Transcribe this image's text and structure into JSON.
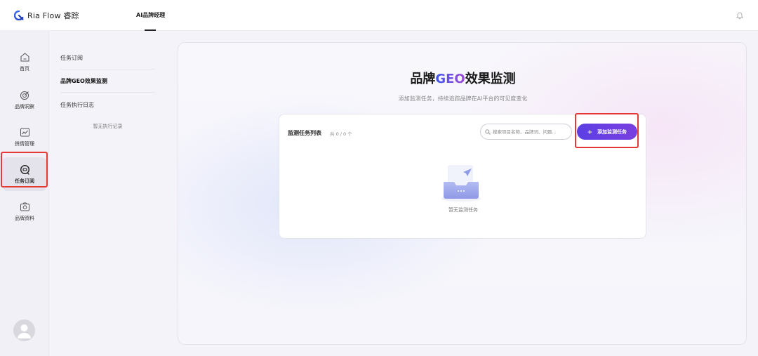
{
  "app": {
    "brand": "Ria Flow 睿踪"
  },
  "header": {
    "nav_item": "AI品牌经理"
  },
  "rail": {
    "items": [
      {
        "label": "首页"
      },
      {
        "label": "品牌洞察"
      },
      {
        "label": "舆情管理"
      },
      {
        "label": "任务订阅"
      },
      {
        "label": "品牌资料"
      }
    ]
  },
  "submenu": {
    "items": [
      {
        "label": "任务订阅"
      },
      {
        "label": "品牌GEO效果监测"
      },
      {
        "label": "任务执行日志"
      }
    ],
    "empty_text": "暂无执行记录"
  },
  "main": {
    "title_prefix": "品牌",
    "title_geo": "GEO",
    "title_suffix": "效果监测",
    "subtitle": "添加监测任务，持续追踪品牌在AI平台的可见度变化",
    "card": {
      "title": "监测任务列表",
      "count": "共 0 / 0 个",
      "search_placeholder": "搜索项目名称、品牌词、问题...",
      "add_button": "添加监测任务",
      "empty_text": "暂无监测任务"
    }
  },
  "colors": {
    "accent": "#6a3fe2",
    "highlight": "#e53935"
  }
}
